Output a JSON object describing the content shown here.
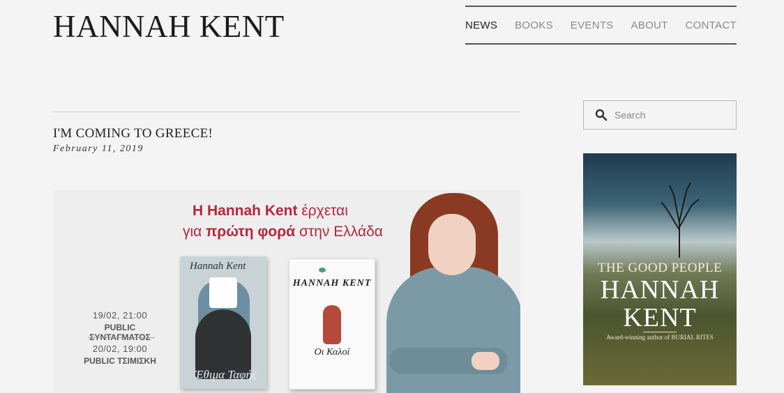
{
  "site": {
    "title": "HANNAH KENT"
  },
  "nav": {
    "items": [
      {
        "label": "NEWS",
        "active": true
      },
      {
        "label": "BOOKS",
        "active": false
      },
      {
        "label": "EVENTS",
        "active": false
      },
      {
        "label": "ABOUT",
        "active": false
      },
      {
        "label": "CONTACT",
        "active": false
      }
    ]
  },
  "post": {
    "title": "I'M COMING TO GREECE!",
    "date": "February 11, 2019",
    "image": {
      "headline_bold": "Η Hannah Kent",
      "headline_rest": "έρχεται",
      "line2_pre": "για ",
      "line2_bold": "πρώτη φορά",
      "line2_post": " στην Ελλάδα",
      "events": [
        {
          "time": "19/02, 21:00",
          "place": "PUBLIC ΣΥΝΤΑΓΜΑΤΟΣ"
        },
        {
          "time": "20/02, 19:00",
          "place": "PUBLIC ΤΣΙΜΙΣΚΗ"
        }
      ],
      "book1": {
        "author": "Hannah Kent",
        "title": "Έθιμα Ταφής"
      },
      "book2": {
        "author": "HANNAH KENT",
        "title": "Οι Καλοί"
      }
    }
  },
  "sidebar": {
    "search": {
      "placeholder": "Search",
      "value": ""
    },
    "ad": {
      "subtitle": "THE GOOD PEOPLE",
      "author_line1": "HANNAH",
      "author_line2": "KENT",
      "tagline": "Award-winning author of BURIAL RITES"
    }
  },
  "colors": {
    "accent": "#b3273b",
    "text": "#222222",
    "nav_inactive": "#8a8a8a"
  }
}
